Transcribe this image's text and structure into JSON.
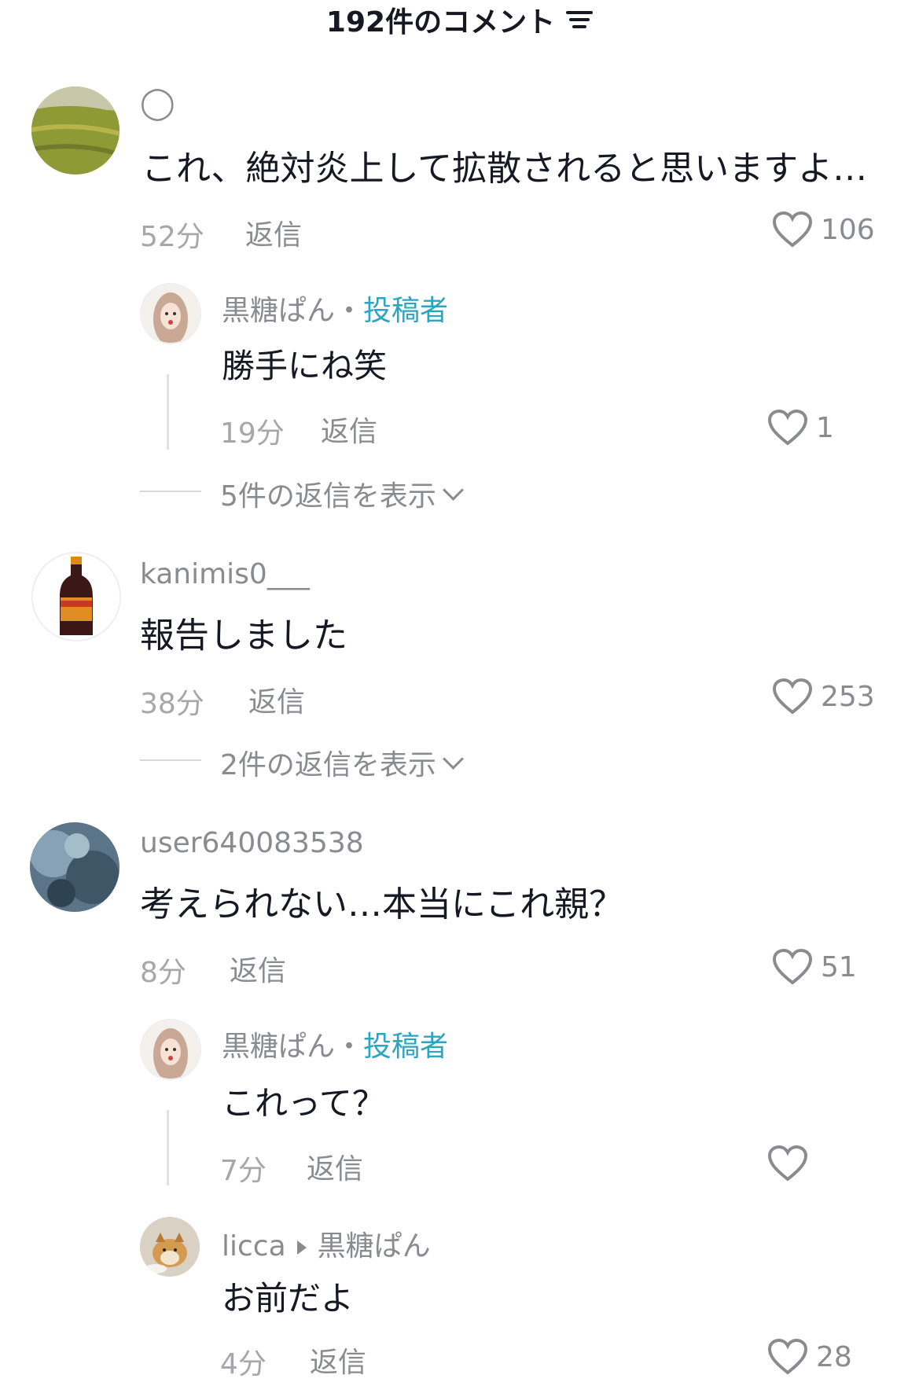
{
  "header": {
    "title": "192件のコメント",
    "filter_icon": "filter-icon"
  },
  "colors": {
    "author_tag": "#2aa6c2",
    "text": "#161823",
    "muted": "#8a8b91"
  },
  "comments": [
    {
      "username": "◯",
      "text": "これ、絶対炎上して拡散されると思いますよ…",
      "time": "52分",
      "reply_label": "返信",
      "likes": "106",
      "avatar": "field-avatar",
      "replies": [
        {
          "username": "黒糖ぱん",
          "separator": "・",
          "author_tag": "投稿者",
          "text": "勝手にね笑",
          "time": "19分",
          "reply_label": "返信",
          "likes": "1"
        }
      ],
      "view_replies": "5件の返信を表示"
    },
    {
      "username": "kanimis0___",
      "text": "報告しました",
      "time": "38分",
      "reply_label": "返信",
      "likes": "253",
      "avatar": "bottle-avatar",
      "view_replies": "2件の返信を表示"
    },
    {
      "username": "user640083538",
      "text": "考えられない…本当にこれ親？",
      "time": "8分",
      "reply_label": "返信",
      "likes": "51",
      "avatar": "blue-avatar",
      "replies": [
        {
          "username": "黒糖ぱん",
          "separator": "・",
          "author_tag": "投稿者",
          "text": "これって？",
          "time": "7分",
          "reply_label": "返信",
          "likes": ""
        },
        {
          "username": "licca",
          "reply_to": "黒糖ぱん",
          "text": "お前だよ",
          "time": "4分",
          "reply_label": "返信",
          "likes": "28"
        }
      ]
    }
  ]
}
